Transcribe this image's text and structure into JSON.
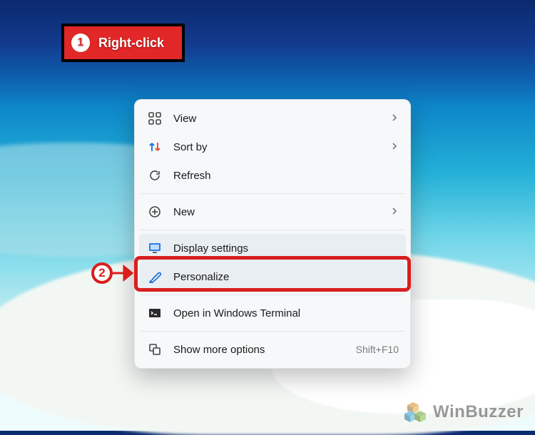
{
  "annotation": {
    "step1_number": "1",
    "step1_label": "Right-click",
    "step2_number": "2"
  },
  "menu": {
    "view": {
      "label": "View",
      "has_sub": true
    },
    "sort": {
      "label": "Sort by",
      "has_sub": true
    },
    "refresh": {
      "label": "Refresh"
    },
    "new": {
      "label": "New",
      "has_sub": true
    },
    "display": {
      "label": "Display settings"
    },
    "personalize": {
      "label": "Personalize"
    },
    "terminal": {
      "label": "Open in Windows Terminal"
    },
    "more": {
      "label": "Show more options",
      "shortcut": "Shift+F10"
    }
  },
  "watermark": {
    "text": "WinBuzzer"
  }
}
